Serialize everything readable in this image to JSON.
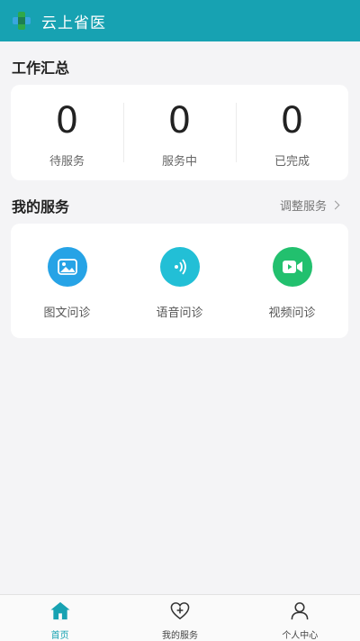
{
  "header": {
    "title": "云上省医"
  },
  "summary": {
    "title": "工作汇总",
    "stats": [
      {
        "value": "0",
        "label": "待服务"
      },
      {
        "value": "0",
        "label": "服务中"
      },
      {
        "value": "0",
        "label": "已完成"
      }
    ]
  },
  "my_services": {
    "title": "我的服务",
    "adjust_label": "调整服务",
    "items": [
      {
        "label": "图文问诊",
        "icon": "image-icon",
        "color": "#26a3e6"
      },
      {
        "label": "语音问诊",
        "icon": "voice-icon",
        "color": "#22bfd6"
      },
      {
        "label": "视频问诊",
        "icon": "video-icon",
        "color": "#22c06e"
      }
    ]
  },
  "nav": {
    "items": [
      {
        "label": "首页",
        "icon": "home-icon",
        "active": true
      },
      {
        "label": "我的服务",
        "icon": "heart-plus-icon",
        "active": false
      },
      {
        "label": "个人中心",
        "icon": "person-icon",
        "active": false
      }
    ]
  },
  "colors": {
    "primary": "#17a2b2",
    "background": "#f4f4f6"
  }
}
